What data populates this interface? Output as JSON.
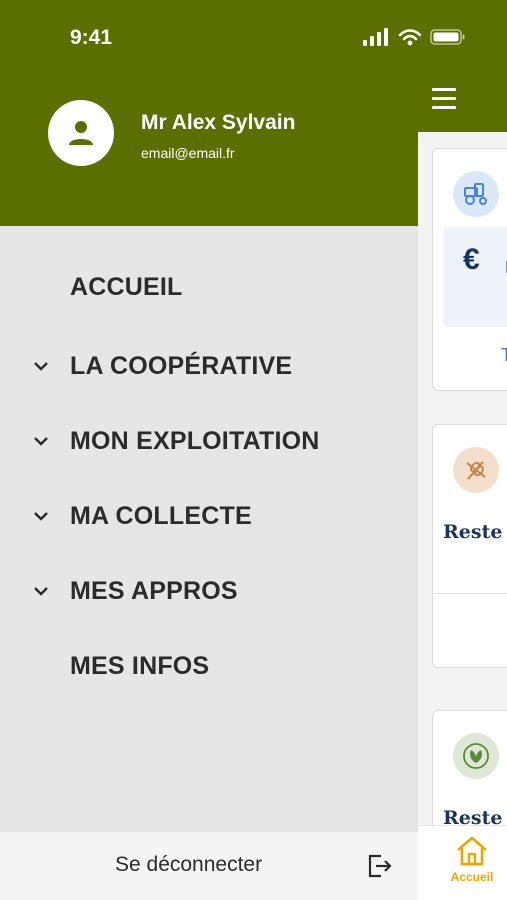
{
  "status_bar": {
    "time": "9:41"
  },
  "user": {
    "name": "Mr Alex Sylvain",
    "email": "email@email.fr"
  },
  "menu": {
    "items": [
      {
        "label": "ACCUEIL",
        "expandable": false
      },
      {
        "label": "LA COOPÉRATIVE",
        "expandable": true
      },
      {
        "label": "MON EXPLOITATION",
        "expandable": true
      },
      {
        "label": "MA COLLECTE",
        "expandable": true
      },
      {
        "label": "MES APPROS",
        "expandable": true
      },
      {
        "label": "MES INFOS",
        "expandable": false
      }
    ]
  },
  "logout": {
    "label": "Se déconnecter"
  },
  "background": {
    "card1": {
      "currency": "€",
      "value_partial": "r",
      "link_partial": "T"
    },
    "card2": {
      "title_partial": "Reste c"
    },
    "card3": {
      "title_partial": "Reste c"
    },
    "tabbar": {
      "home_label": "Accueil"
    }
  },
  "colors": {
    "brand_green": "#5b6e00",
    "drawer_bg": "#e6e6e6",
    "accent_yellow": "#e9a800",
    "navy": "#17335f"
  }
}
